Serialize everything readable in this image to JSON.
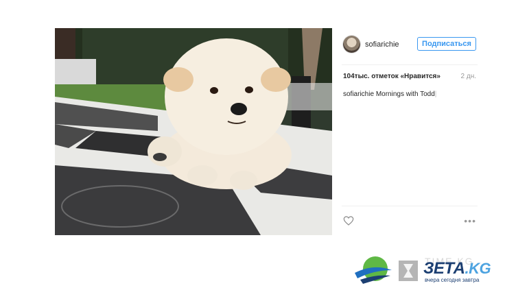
{
  "post": {
    "username": "sofiarichie",
    "follow_label": "Подписаться",
    "likes": "104тыс. отметок «Нравится»",
    "time_ago": "2 дн.",
    "caption": {
      "user": "sofiarichie",
      "text": "Mornings with Todd"
    },
    "more_label": "•••"
  },
  "watermark": {
    "ghost_text": "TIME.KG",
    "brand_main": "ЗЕТА",
    "brand_suffix": ".KG",
    "tagline": "вчера сегодня завтра"
  },
  "colors": {
    "accent": "#3897f0",
    "brand_dark": "#1c3f72",
    "brand_light": "#4da3e0"
  },
  "icons": [
    "heart-icon",
    "more-options-icon",
    "globe-logo-icon",
    "hourglass-icon"
  ]
}
